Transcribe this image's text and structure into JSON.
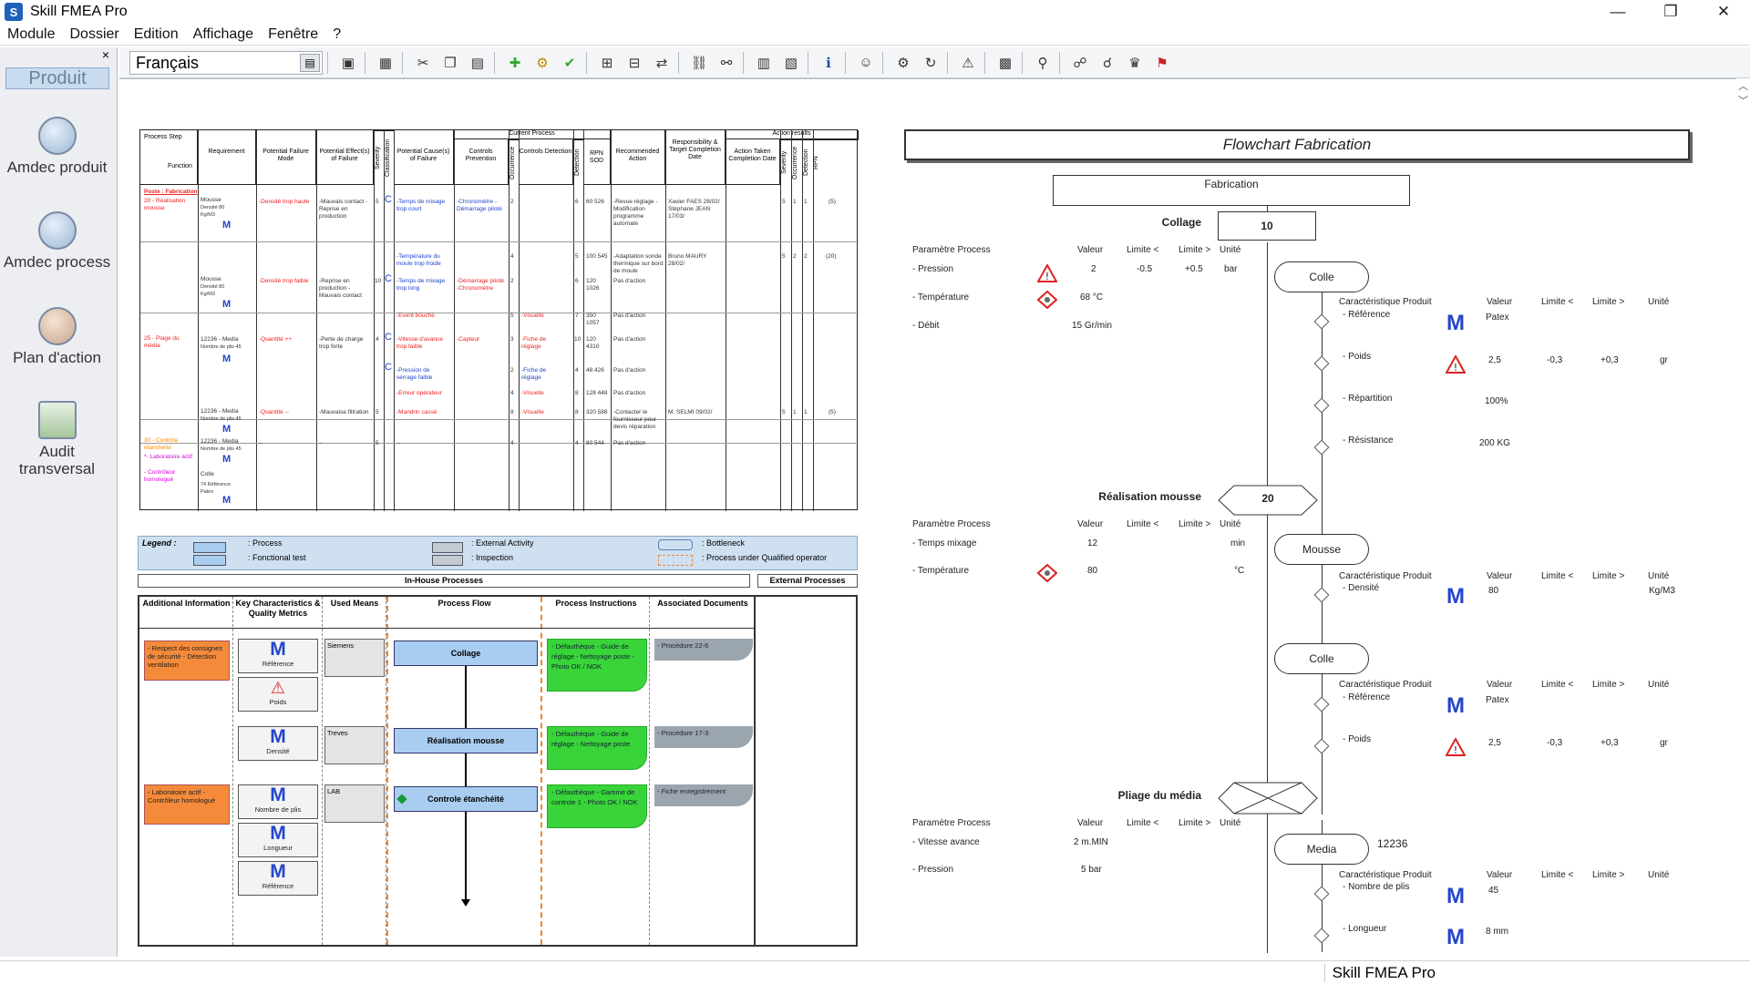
{
  "window": {
    "title": "Skill FMEA Pro",
    "app_icon": "S"
  },
  "menu": [
    "Module",
    "Dossier",
    "Edition",
    "Affichage",
    "Fenêtre",
    "?"
  ],
  "left_panel": {
    "close": "×",
    "tab": "Produit",
    "items": [
      {
        "label": "Amdec produit",
        "icon": "amdec-produit-icon"
      },
      {
        "label": "Amdec process",
        "icon": "amdec-process-icon"
      },
      {
        "label": "Plan d'action",
        "icon": "plan-action-icon"
      },
      {
        "label": "Audit transversal",
        "icon": "audit-icon"
      }
    ]
  },
  "toolbar": {
    "language": "Français"
  },
  "status": {
    "app_name": "Skill FMEA Pro"
  },
  "fmea": {
    "headers": [
      "Process Step",
      "Function",
      "Requirement",
      "Potential Failure Mode",
      "Potential Effect(s) of Failure",
      "Severity",
      "Classification",
      "Potential Cause(s) of Failure",
      "Current Process",
      "Controls Prevention",
      "Occurrence",
      "Controls Detection",
      "Detection",
      "RPN SOD",
      "Recommended Action",
      "Responsibility & Target Completion Date",
      "Action results",
      "Action Taken Completion Date",
      "Severity",
      "Occurrence",
      "Detection",
      "RPN"
    ],
    "poste": "Poste : Fabrication",
    "step1": "20 - Réalisation mousse",
    "step2": "25 - Plage du média",
    "step3": "30 - Contrôle étanchéité",
    "step3b": "*- Laboratoire actif",
    "step3c": "- Contrôleur homologué",
    "req1": "Mousse",
    "req1b": "Densité 80 Kg/M3",
    "req2": "Mousse",
    "req2b": "Densité 80 Kg/M3",
    "req3": "12236 - Media",
    "req3b": "Nombre de plis 45",
    "req4": "12236 - Media",
    "req4b": "Nombre de plis 45",
    "req5": "12236 - Media",
    "req5b": "Nombre de plis 45",
    "req6": "Colle",
    "req6b": "74 Référence Patex",
    "M": "M",
    "fm1": "-Densité trop haute",
    "fm2": "-Densité trop faible",
    "fm3": "-Quantité ++",
    "fm4": "-Quantité --",
    "fm5": "--",
    "ef1": "-Mauvais contact -Reprise en production",
    "ef2": "-Reprise en production -Mauvais contact",
    "ef3": "-Perte de charge trop forte",
    "ef4": "-Mauvaise filtration",
    "ef5": "--",
    "s1": "5",
    "s2": "10",
    "s3": "4",
    "s4": "5",
    "s5": "5",
    "cls": "C",
    "c1": "-Temps de mixage trop court",
    "c2": "-Température du moule trop froide",
    "c3": "-Temps de mixage trop long",
    "c4": "-Event bouché",
    "c5": "-Vitesse d'avance trop faible",
    "c6": "-Pression de serrage faible",
    "c7": "-Erreur opérateur",
    "c8": "-Mandrin cassé",
    "c9": "--",
    "p1": "-Chronomètre -Démarrage piloté",
    "p2": "-Démarrage piloté -Chronomètre",
    "p3": "-Capteur",
    "d1": "-Visuelle",
    "d2": "-Fiche de réglage",
    "d3": "-Fiche de réglage",
    "d4": "-Visuelle",
    "d5": "-Visuelle",
    "o": [
      "2",
      "4",
      "2",
      "5",
      "3",
      "2",
      "4",
      "8",
      "4"
    ],
    "det": [
      "6",
      "5",
      "6",
      "7",
      "10",
      "4",
      "8",
      "8",
      "4"
    ],
    "rpn": [
      "60 526",
      "100 545",
      "120 1026",
      "350 1057",
      "120 4310",
      "48 426",
      "128 448",
      "320 588",
      "80 544"
    ],
    "ra": [
      "-Revue réglage -Modification programme automate",
      "-Adaptation sonde thermique sur bord de moule",
      "Pas d'action",
      "Pas d'action",
      "Pas d'action",
      "Pas d'action",
      "Pas d'action",
      "-Contacter le fournisseur pour devis réparation",
      "Pas d'action"
    ],
    "resp": [
      "Xavier FAES 28/02/ Stéphane JEAN 17/03/",
      "Bruno MAURY 28/02/",
      "M. SELMI 09/02/"
    ],
    "res": [
      "5",
      "1",
      "1",
      "(5)",
      "5",
      "2",
      "2",
      "(20)",
      "5",
      "1",
      "1",
      "(5)"
    ]
  },
  "legend": {
    "title": "Legend :",
    "process": ": Process",
    "functional_test": ": Fonctional test",
    "external": ": External Activity",
    "inspection": ": Inspection",
    "bottleneck": ": Bottleneck",
    "qualified": ": Process under Qualified operator"
  },
  "lanes": {
    "inhouse": "In-House Processes",
    "external": "External Processes",
    "cols": [
      "Additional Information",
      "Key Characteristics & Quality Metrics",
      "Used Means",
      "Process Flow",
      "Process Instructions",
      "Associated Documents"
    ],
    "info1": "- Respect des consignes de sécurité - Détection ventilation",
    "info2": "- Laboratoire actif - Contrôleur homologué",
    "metrics": [
      "Référence",
      "Poids",
      "Densité",
      "Nombre de plis",
      "Longueur",
      "Référence"
    ],
    "means": [
      "Siemens",
      "Treves",
      "LAB"
    ],
    "flows": [
      "Collage",
      "Réalisation mousse",
      "Controle étanchéité"
    ],
    "instr1": "- Défauthèque - Guide de réglage - Nettoyage poste - Photo OK / NOK",
    "instr2": "- Défauthèque - Guide de réglage - Nettoyage poste",
    "instr3": "- Défauthèque - Gamme de controle 1 - Photo OK / NOK",
    "docs": [
      "- Procédure 22-6",
      "- Procédure 17-3",
      "- Fiche enregistrement"
    ]
  },
  "flowchart": {
    "title": "Flowchart Fabrication",
    "root": "Fabrication",
    "stage1": {
      "name": "Collage",
      "num": "10"
    },
    "stage2": {
      "name": "Réalisation mousse",
      "num": "20"
    },
    "stage3": {
      "name": "Pliage du média",
      "num": ""
    },
    "hdr": {
      "param": "Paramètre Process",
      "val": "Valeur",
      "lmin": "Limite <",
      "lmax": "Limite >",
      "unit": "Unité",
      "carac": "Caractéristique Produit"
    },
    "s1params": [
      {
        "name": "- Pression",
        "val": "2",
        "lmin": "-0.5",
        "lmax": "+0.5",
        "unit": "bar"
      },
      {
        "name": "- Température",
        "val": "68 °C",
        "lmin": "",
        "lmax": "",
        "unit": ""
      },
      {
        "name": "- Débit",
        "val": "15 Gr/min",
        "lmin": "",
        "lmax": "",
        "unit": ""
      }
    ],
    "colle": "Colle",
    "colle_chars": [
      {
        "name": "- Référence",
        "val": "Patex",
        "lmin": "",
        "lmax": "",
        "unit": ""
      },
      {
        "name": "- Poids",
        "val": "2,5",
        "lmin": "-0,3",
        "lmax": "+0,3",
        "unit": "gr"
      },
      {
        "name": "- Répartition",
        "val": "100%",
        "lmin": "",
        "lmax": "",
        "unit": ""
      },
      {
        "name": "- Résistance",
        "val": "200 KG",
        "lmin": "",
        "lmax": "",
        "unit": ""
      }
    ],
    "s2params": [
      {
        "name": "- Temps mixage",
        "val": "12",
        "unit": "min"
      },
      {
        "name": "- Température",
        "val": "80",
        "unit": "°C"
      }
    ],
    "mousse": "Mousse",
    "mousse_char": {
      "name": "- Densité",
      "val": "80",
      "unit": "Kg/M3"
    },
    "colle2": "Colle",
    "colle2_chars": [
      {
        "name": "- Référence",
        "val": "Patex",
        "lmin": "",
        "lmax": "",
        "unit": ""
      },
      {
        "name": "- Poids",
        "val": "2,5",
        "lmin": "-0,3",
        "lmax": "+0,3",
        "unit": "gr"
      }
    ],
    "s3params": [
      {
        "name": "- Vitesse avance",
        "val": "2 m.MIN"
      },
      {
        "name": "- Pression",
        "val": "5 bar"
      }
    ],
    "media": "Media",
    "media_code": "12236",
    "media_chars": [
      {
        "name": "- Nombre de plis",
        "val": "45"
      },
      {
        "name": "- Longueur",
        "val": "8 mm"
      }
    ],
    "M": "M"
  }
}
